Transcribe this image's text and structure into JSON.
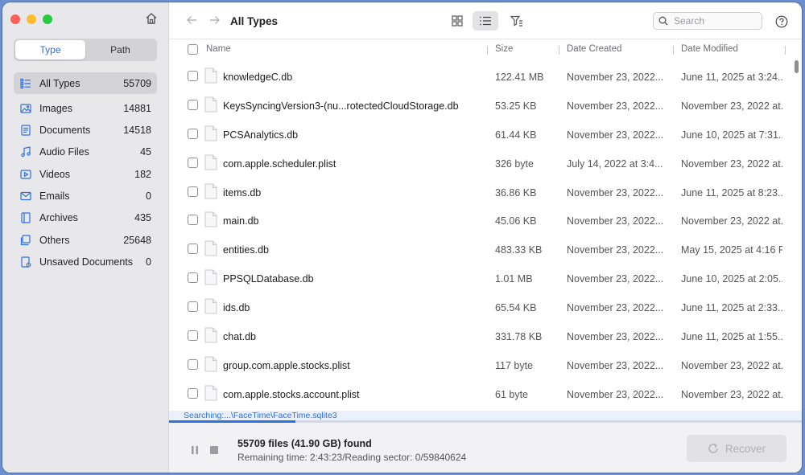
{
  "sidebar": {
    "segments": [
      {
        "label": "Type",
        "active": true
      },
      {
        "label": "Path",
        "active": false
      }
    ],
    "items": [
      {
        "label": "All Types",
        "count": "55709",
        "icon": "list-icon",
        "selected": true
      },
      {
        "label": "Images",
        "count": "14881",
        "icon": "image-icon"
      },
      {
        "label": "Documents",
        "count": "14518",
        "icon": "document-icon"
      },
      {
        "label": "Audio Files",
        "count": "45",
        "icon": "music-note-icon"
      },
      {
        "label": "Videos",
        "count": "182",
        "icon": "video-icon"
      },
      {
        "label": "Emails",
        "count": "0",
        "icon": "envelope-icon"
      },
      {
        "label": "Archives",
        "count": "435",
        "icon": "archive-icon"
      },
      {
        "label": "Others",
        "count": "25648",
        "icon": "stack-icon"
      },
      {
        "label": "Unsaved Documents",
        "count": "0",
        "icon": "unsaved-document-icon"
      }
    ]
  },
  "toolbar": {
    "title": "All Types",
    "search_placeholder": "Search"
  },
  "table": {
    "headers": {
      "name": "Name",
      "size": "Size",
      "created": "Date Created",
      "modified": "Date Modified"
    },
    "rows": [
      {
        "name": "knowledgeC.db",
        "size": "122.41 MB",
        "created": "November 23, 2022...",
        "modified": "June 11, 2025 at 3:24..."
      },
      {
        "name": "KeysSyncingVersion3-(nu...rotectedCloudStorage.db",
        "size": "53.25 KB",
        "created": "November 23, 2022...",
        "modified": "November 23, 2022 at..."
      },
      {
        "name": "PCSAnalytics.db",
        "size": "61.44 KB",
        "created": "November 23, 2022...",
        "modified": "June 10, 2025 at 7:31..."
      },
      {
        "name": "com.apple.scheduler.plist",
        "size": "326 byte",
        "created": "July 14, 2022 at 3:4...",
        "modified": "November 23, 2022 at..."
      },
      {
        "name": "items.db",
        "size": "36.86 KB",
        "created": "November 23, 2022...",
        "modified": "June 11, 2025 at 8:23..."
      },
      {
        "name": "main.db",
        "size": "45.06 KB",
        "created": "November 23, 2022...",
        "modified": "November 23, 2022 at..."
      },
      {
        "name": "entities.db",
        "size": "483.33 KB",
        "created": "November 23, 2022...",
        "modified": "May 15, 2025 at 4:16 PM"
      },
      {
        "name": "PPSQLDatabase.db",
        "size": "1.01 MB",
        "created": "November 23, 2022...",
        "modified": "June 10, 2025 at 2:05..."
      },
      {
        "name": "ids.db",
        "size": "65.54 KB",
        "created": "November 23, 2022...",
        "modified": "June 11, 2025 at 2:33..."
      },
      {
        "name": "chat.db",
        "size": "331.78 KB",
        "created": "November 23, 2022...",
        "modified": "June 11, 2025 at 1:55..."
      },
      {
        "name": "group.com.apple.stocks.plist",
        "size": "117 byte",
        "created": "November 23, 2022...",
        "modified": "November 23, 2022 at..."
      },
      {
        "name": "com.apple.stocks.account.plist",
        "size": "61 byte",
        "created": "November 23, 2022...",
        "modified": "November 23, 2022 at..."
      }
    ]
  },
  "status": {
    "searching": "Searching:...\\FaceTime\\FaceTime.sqlite3",
    "progress": 0.2,
    "found": "55709 files (41.90 GB) found",
    "remaining": "Remaining time: 2:43:23/Reading sector: 0/59840624",
    "recover_label": "Recover"
  },
  "colors": {
    "accent": "#2f6fdf",
    "sidebar_bg": "#e8e8ea",
    "selected_bg": "#d4d4d8"
  }
}
